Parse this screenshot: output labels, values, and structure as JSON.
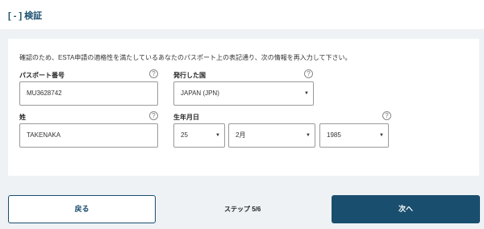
{
  "section": {
    "title": "[ - ] 検証"
  },
  "form": {
    "intro": "確認のため、ESTA申請の適格性を満たしているあなたのパスポート上の表記通り、次の情報を再入力して下さい。",
    "help_glyph": "?",
    "passport_number": {
      "label": "パスポート番号",
      "value": "MU3628742"
    },
    "issuing_country": {
      "label": "発行した国",
      "value": "JAPAN (JPN)"
    },
    "surname": {
      "label": "姓",
      "value": "TAKENAKA"
    },
    "birth_date": {
      "label": "生年月日",
      "day": "25",
      "month": "2月",
      "year": "1985"
    },
    "dropdown_glyph": "▼"
  },
  "footer": {
    "back_label": "戻る",
    "step_text": "ステップ 5/6",
    "next_label": "次へ"
  },
  "colors": {
    "accent": "#1a4e6e",
    "background": "#eef2f5"
  }
}
